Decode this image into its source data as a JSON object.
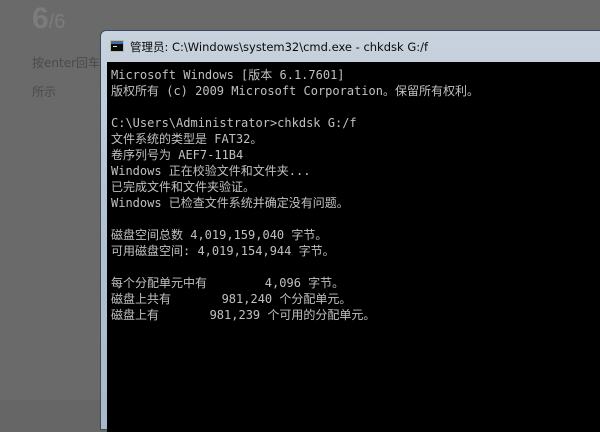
{
  "background": {
    "counter_current": "6",
    "counter_total": "/6",
    "text_line_1": "按enter回车",
    "text_line_2": "所示"
  },
  "window": {
    "title": "管理员: C:\\Windows\\system32\\cmd.exe - chkdsk  G:/f",
    "icon": "cmd-icon"
  },
  "console": {
    "lines": [
      "Microsoft Windows [版本 6.1.7601]",
      "版权所有 (c) 2009 Microsoft Corporation。保留所有权利。",
      "",
      "C:\\Users\\Administrator>chkdsk G:/f",
      "文件系统的类型是 FAT32。",
      "卷序列号为 AEF7-11B4",
      "Windows 正在校验文件和文件夹...",
      "已完成文件和文件夹验证。",
      "Windows 已检查文件系统并确定没有问题。",
      "",
      "磁盘空间总数 4,019,159,040 字节。",
      "可用磁盘空间: 4,019,154,944 字节。",
      "",
      "每个分配单元中有        4,096 字节。",
      "磁盘上共有       981,240 个分配单元。",
      "磁盘上有       981,239 个可用的分配单元。"
    ]
  },
  "colors": {
    "console_bg": "#000000",
    "console_text": "#c0c0c0",
    "page_bg": "#6a6a6a"
  }
}
